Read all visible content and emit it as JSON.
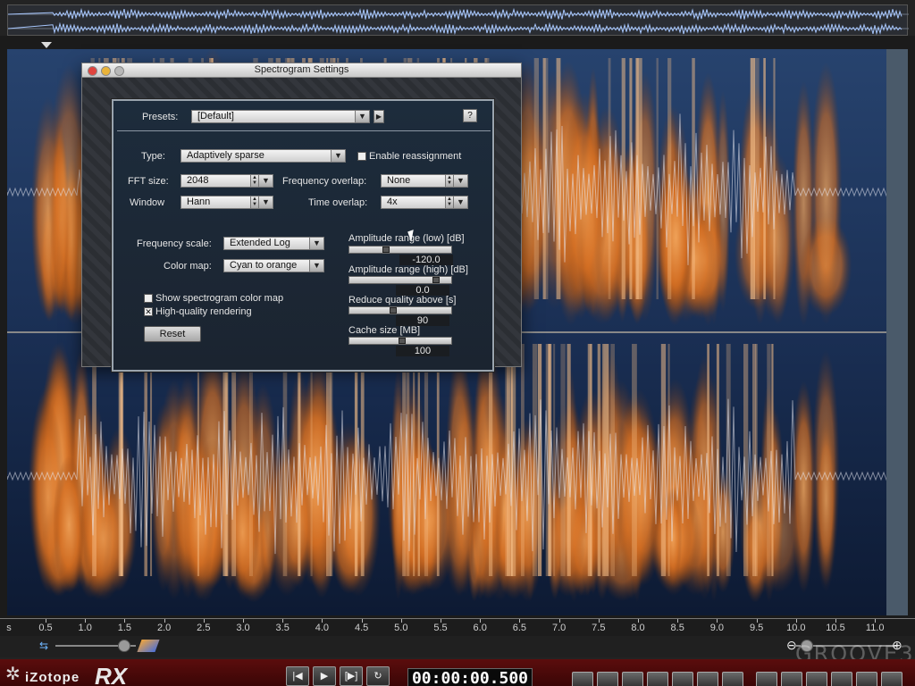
{
  "app": {
    "brand": "iZotope",
    "product": "RX"
  },
  "timeline": {
    "unit_label": "s",
    "ticks": [
      "0.5",
      "1.0",
      "1.5",
      "2.0",
      "2.5",
      "3.0",
      "3.5",
      "4.0",
      "4.5",
      "5.0",
      "5.5",
      "6.0",
      "6.5",
      "7.0",
      "7.5",
      "8.0",
      "8.5",
      "9.0",
      "9.5",
      "10.0",
      "10.5",
      "11.0"
    ]
  },
  "transport": {
    "time": "00:00:00.500",
    "buttons": [
      {
        "name": "go-to-start",
        "glyph": "|◀"
      },
      {
        "name": "play",
        "glyph": "▶"
      },
      {
        "name": "play-selection",
        "glyph": "[▶]"
      },
      {
        "name": "loop",
        "glyph": "↻"
      }
    ]
  },
  "watermark": "GROOVE3",
  "dialog": {
    "title": "Spectrogram Settings",
    "presets_label": "Presets:",
    "presets_value": "[Default]",
    "help_label": "?",
    "type_label": "Type:",
    "type_value": "Adaptively sparse",
    "enable_reassignment_label": "Enable reassignment",
    "enable_reassignment_checked": false,
    "fft_size_label": "FFT size:",
    "fft_size_value": "2048",
    "frequency_overlap_label": "Frequency overlap:",
    "frequency_overlap_value": "None",
    "window_label": "Window",
    "window_value": "Hann",
    "time_overlap_label": "Time overlap:",
    "time_overlap_value": "4x",
    "frequency_scale_label": "Frequency scale:",
    "frequency_scale_value": "Extended Log",
    "color_map_label": "Color map:",
    "color_map_value": "Cyan to orange",
    "show_color_map_label": "Show spectrogram color map",
    "show_color_map_checked": false,
    "hq_rendering_label": "High-quality rendering",
    "hq_rendering_checked": true,
    "reset_label": "Reset",
    "amp_low_label": "Amplitude range (low)  [dB]",
    "amp_low_value": "-120.0",
    "amp_low_level": 0.35,
    "amp_high_label": "Amplitude range (high)  [dB]",
    "amp_high_value": "0.0",
    "amp_high_level": 0.88,
    "reduce_quality_label": "Reduce quality above [s]",
    "reduce_quality_value": "90",
    "reduce_quality_level": 0.42,
    "cache_size_label": "Cache size [MB]",
    "cache_size_value": "100",
    "cache_size_level": 0.52
  },
  "colors": {
    "accent_orange": "#e8822a",
    "spectro_blue": "#1a2e52",
    "brand_red": "#5b0d0d"
  }
}
